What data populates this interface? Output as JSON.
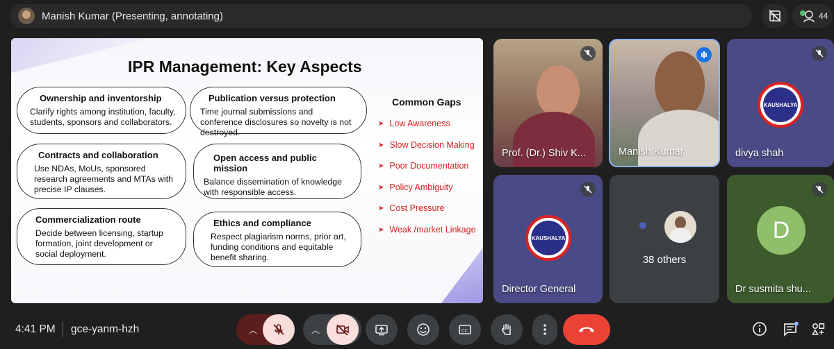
{
  "topbar": {
    "presenter_label": "Manish Kumar (Presenting, annotating)",
    "participant_count": "44"
  },
  "slide": {
    "title": "IPR Management: Key Aspects",
    "pills": [
      {
        "title": "Ownership and inventorship",
        "body": "Clarify rights among institution, faculty, students, sponsors and collaborators."
      },
      {
        "title": "Publication versus protection",
        "body": "Time journal submissions and conference disclosures so novelty is not destroyed."
      },
      {
        "title": "Contracts and collaboration",
        "body": "Use NDAs, MoUs, sponsored research agreements and MTAs with precise IP clauses."
      },
      {
        "title": "Open access and public mission",
        "body": "Balance dissemination of knowledge with responsible access."
      },
      {
        "title": "Commercialization route",
        "body": "Decide between licensing, startup formation, joint development or social deployment."
      },
      {
        "title": "Ethics and compliance",
        "body": "Respect plagiarism norms, prior art, funding conditions and equitable benefit sharing."
      }
    ],
    "gaps_title": "Common Gaps",
    "gaps": [
      "Low Awareness",
      "Slow Decision Making",
      "Poor Documentation",
      "Policy Ambiguity",
      "Cost Pressure",
      "Weak /market Linkage"
    ]
  },
  "tiles": {
    "shiv": "Prof. (Dr.) Shiv K...",
    "manish": "Manish Kumar",
    "divya": "divya shah",
    "director": "Director General",
    "others": "38 others",
    "susmita": "Dr susmita shu...",
    "susmita_initial": "D",
    "logo_text": "KAUSHALYA"
  },
  "bottom": {
    "time": "4:41 PM",
    "meeting_code": "gce-yanm-hzh"
  },
  "colors": {
    "background": "#1f1f1f",
    "accent_blue": "#1a73e8",
    "end_call": "#ea4335",
    "gap_red": "#d32222"
  }
}
